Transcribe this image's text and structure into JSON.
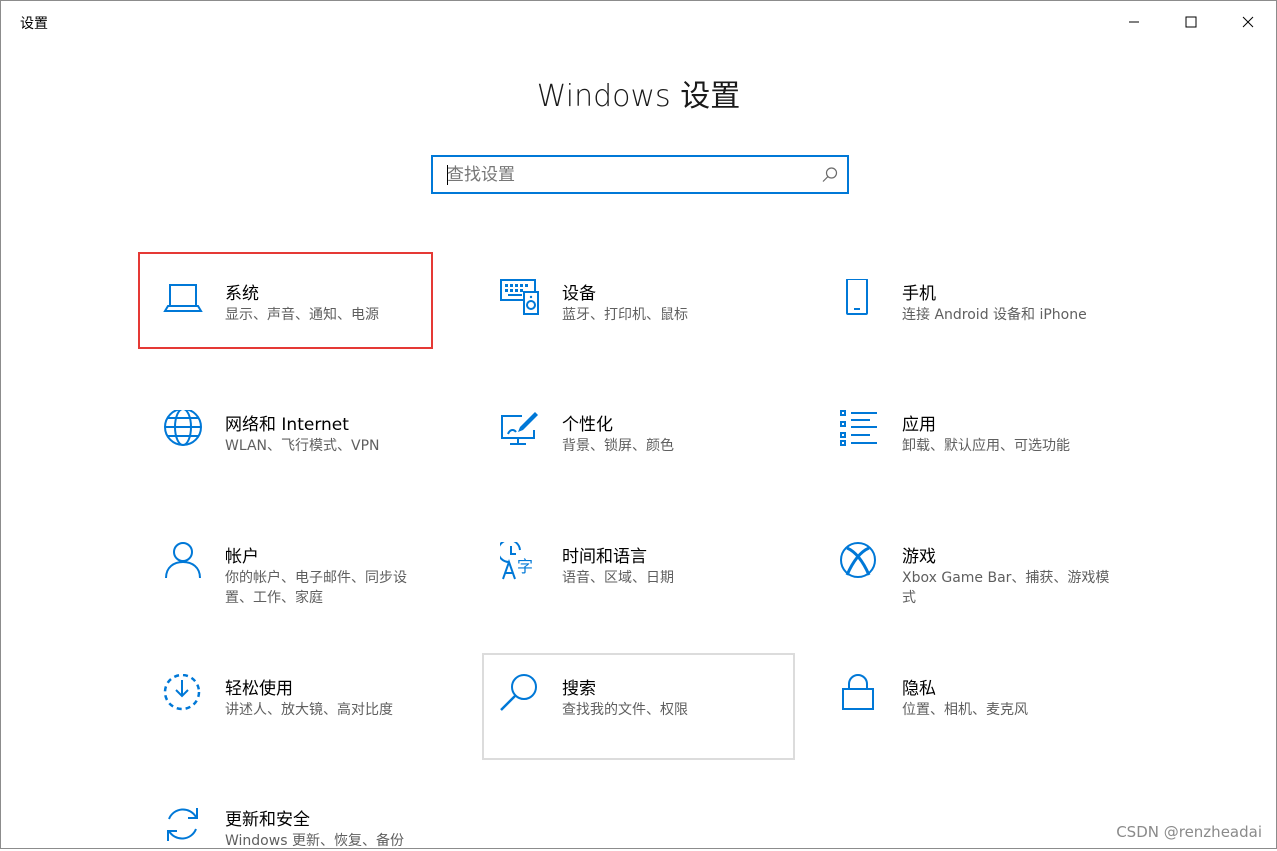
{
  "window": {
    "title": "设置",
    "controls": {
      "minimize": "minimize-icon",
      "maximize": "maximize-icon",
      "close": "close-icon"
    }
  },
  "header": {
    "title": "Windows 设置"
  },
  "search": {
    "placeholder": "查找设置",
    "value": ""
  },
  "tiles": [
    {
      "title": "系统",
      "desc": "显示、声音、通知、电源",
      "icon": "laptop-icon",
      "state": "selected"
    },
    {
      "title": "设备",
      "desc": "蓝牙、打印机、鼠标",
      "icon": "devices-icon"
    },
    {
      "title": "手机",
      "desc": "连接 Android 设备和 iPhone",
      "icon": "phone-icon"
    },
    {
      "title": "网络和 Internet",
      "desc": "WLAN、飞行模式、VPN",
      "icon": "globe-icon"
    },
    {
      "title": "个性化",
      "desc": "背景、锁屏、颜色",
      "icon": "personalization-icon"
    },
    {
      "title": "应用",
      "desc": "卸载、默认应用、可选功能",
      "icon": "apps-list-icon"
    },
    {
      "title": "帐户",
      "desc": "你的帐户、电子邮件、同步设置、工作、家庭",
      "icon": "person-icon"
    },
    {
      "title": "时间和语言",
      "desc": "语音、区域、日期",
      "icon": "time-language-icon"
    },
    {
      "title": "游戏",
      "desc": "Xbox Game Bar、捕获、游戏模式",
      "icon": "xbox-icon"
    },
    {
      "title": "轻松使用",
      "desc": "讲述人、放大镜、高对比度",
      "icon": "ease-of-access-icon"
    },
    {
      "title": "搜索",
      "desc": "查找我的文件、权限",
      "icon": "magnifier-icon",
      "state": "hover"
    },
    {
      "title": "隐私",
      "desc": "位置、相机、麦克风",
      "icon": "lock-icon"
    },
    {
      "title": "更新和安全",
      "desc": "Windows 更新、恢复、备份",
      "icon": "sync-icon"
    }
  ],
  "watermark": "CSDN @renzheadai",
  "colors": {
    "accent": "#0078d7",
    "selection_border": "#e53935",
    "hover_border": "#dcdcdc"
  }
}
